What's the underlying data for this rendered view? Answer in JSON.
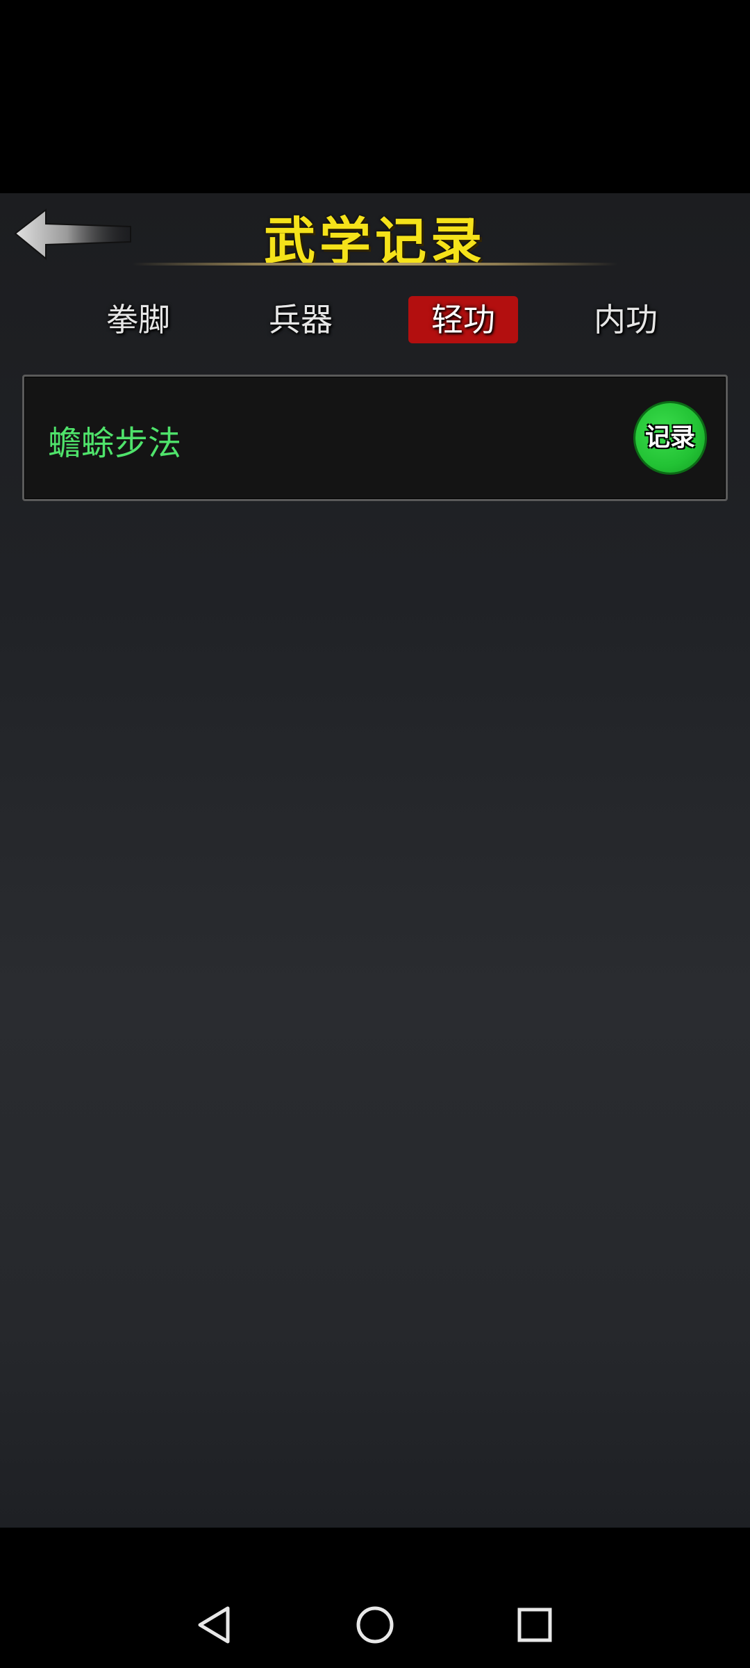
{
  "header": {
    "title": "武学记录"
  },
  "tabs": [
    {
      "label": "拳脚",
      "active": false
    },
    {
      "label": "兵器",
      "active": false
    },
    {
      "label": "轻功",
      "active": true
    },
    {
      "label": "内功",
      "active": false
    }
  ],
  "records": [
    {
      "name": "蟾蜍步法",
      "button_label": "记录"
    }
  ],
  "colors": {
    "title": "#f5e21a",
    "active_tab": "#b30f0f",
    "record_name": "#4fe36b",
    "record_button": "#22c234"
  },
  "icons": {
    "back": "back-arrow-icon",
    "nav_back": "triangle-back-icon",
    "nav_home": "circle-home-icon",
    "nav_recents": "square-recents-icon"
  }
}
